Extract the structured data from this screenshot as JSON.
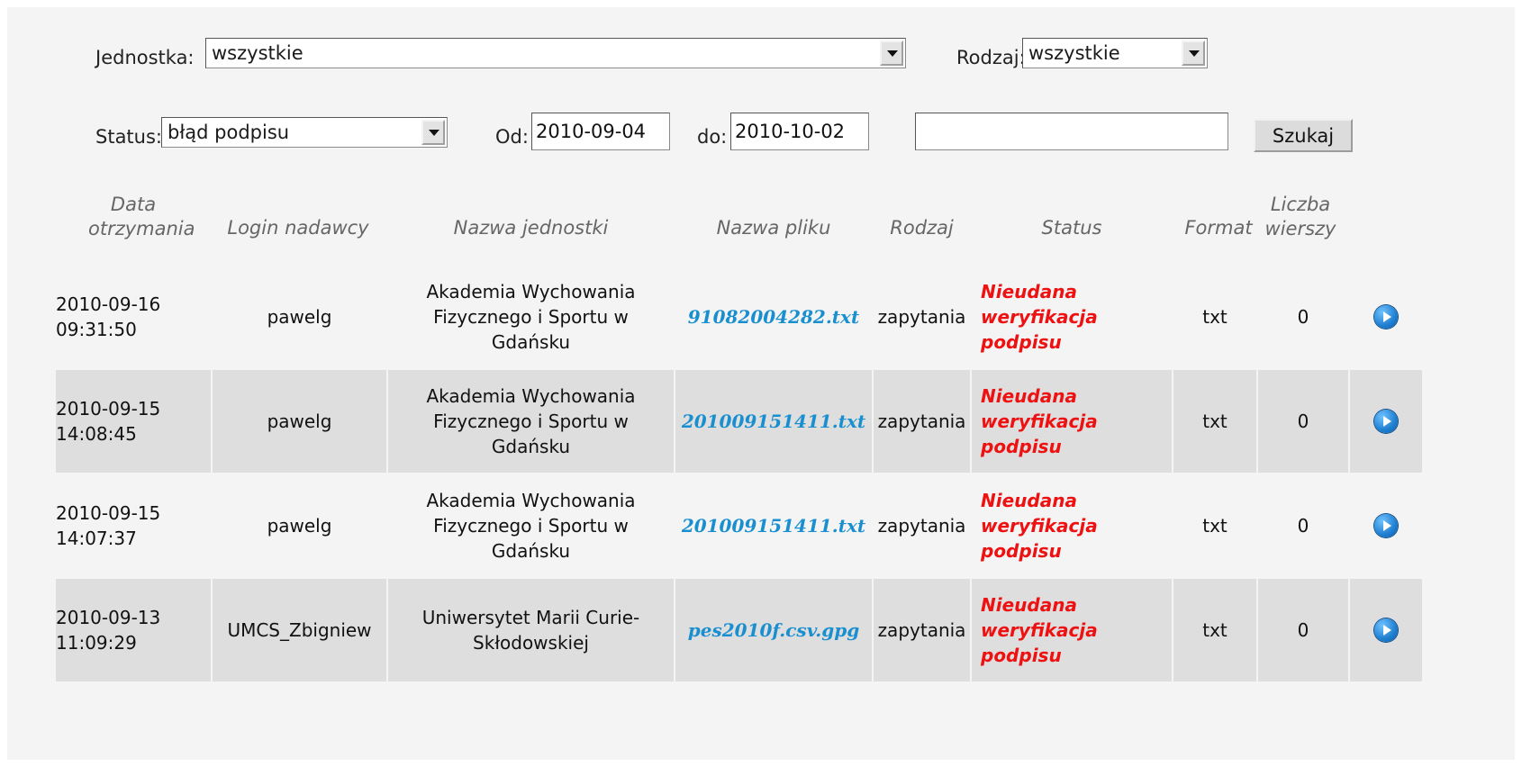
{
  "filters": {
    "unit_label": "Jednostka:",
    "unit_value": "wszystkie",
    "type_label": "Rodzaj:",
    "type_value": "wszystkie",
    "status_label": "Status:",
    "status_value": "błąd podpisu",
    "from_label": "Od:",
    "from_value": "2010-09-04",
    "to_label": "do:",
    "to_value": "2010-10-02",
    "search_value": "",
    "search_button": "Szukaj"
  },
  "table": {
    "headers": {
      "date": "Data otrzymania",
      "login": "Login nadawcy",
      "unit": "Nazwa jednostki",
      "file": "Nazwa pliku",
      "type": "Rodzaj",
      "status": "Status",
      "format": "Format",
      "count": "Liczba wierszy"
    },
    "rows": [
      {
        "date": "2010-09-16",
        "time": "09:31:50",
        "login": "pawelg",
        "unit": "Akademia Wychowania Fizycznego i Sportu w Gdańsku",
        "file": "91082004282.txt",
        "type": "zapytania",
        "status": "Nieudana weryfikacja podpisu",
        "format": "txt",
        "count": "0"
      },
      {
        "date": "2010-09-15",
        "time": "14:08:45",
        "login": "pawelg",
        "unit": "Akademia Wychowania Fizycznego i Sportu w Gdańsku",
        "file": "201009151411.txt",
        "type": "zapytania",
        "status": "Nieudana weryfikacja podpisu",
        "format": "txt",
        "count": "0"
      },
      {
        "date": "2010-09-15",
        "time": "14:07:37",
        "login": "pawelg",
        "unit": "Akademia Wychowania Fizycznego i Sportu w Gdańsku",
        "file": "201009151411.txt",
        "type": "zapytania",
        "status": "Nieudana weryfikacja podpisu",
        "format": "txt",
        "count": "0"
      },
      {
        "date": "2010-09-13",
        "time": "11:09:29",
        "login": "UMCS_Zbigniew",
        "unit": "Uniwersytet Marii Curie-Skłodowskiej",
        "file": "pes2010f.csv.gpg",
        "type": "zapytania",
        "status": "Nieudana weryfikacja podpisu",
        "format": "txt",
        "count": "0"
      }
    ]
  },
  "icons": {
    "row_action": "play-icon"
  },
  "colors": {
    "link": "#1a8fd0",
    "status_error": "#ee1111",
    "row_alt": "#dedede"
  }
}
